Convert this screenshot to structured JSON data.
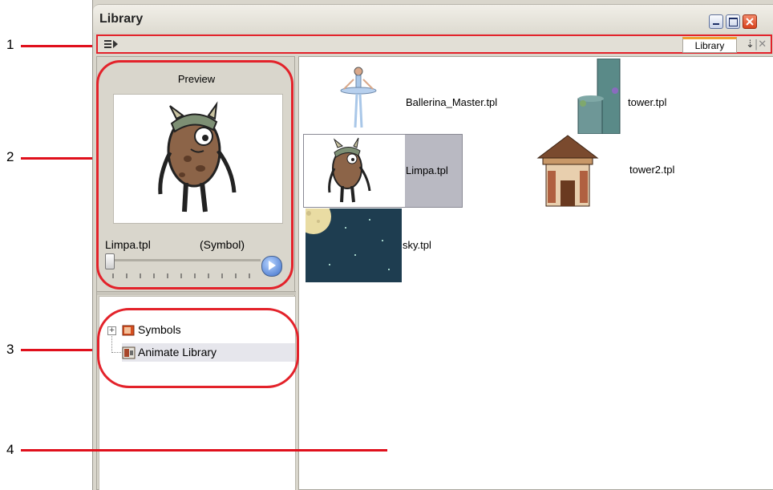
{
  "callouts": [
    "1",
    "2",
    "3",
    "4"
  ],
  "window": {
    "title": "Library",
    "tab_label": "Library"
  },
  "preview": {
    "header": "Preview",
    "item_name": "Limpa.tpl",
    "item_type": "(Symbol)"
  },
  "tree": {
    "items": [
      {
        "label": "Symbols"
      },
      {
        "label": "Animate Library"
      }
    ]
  },
  "library_items": [
    {
      "label": "Ballerina_Master.tpl"
    },
    {
      "label": "tower.tpl"
    },
    {
      "label": "Limpa.tpl"
    },
    {
      "label": "tower2.tpl"
    },
    {
      "label": "sky.tpl"
    }
  ],
  "colors": {
    "callout_red": "#e3222a",
    "selection_bg": "#b9b9c2",
    "sky_bg": "#1e3d50"
  }
}
